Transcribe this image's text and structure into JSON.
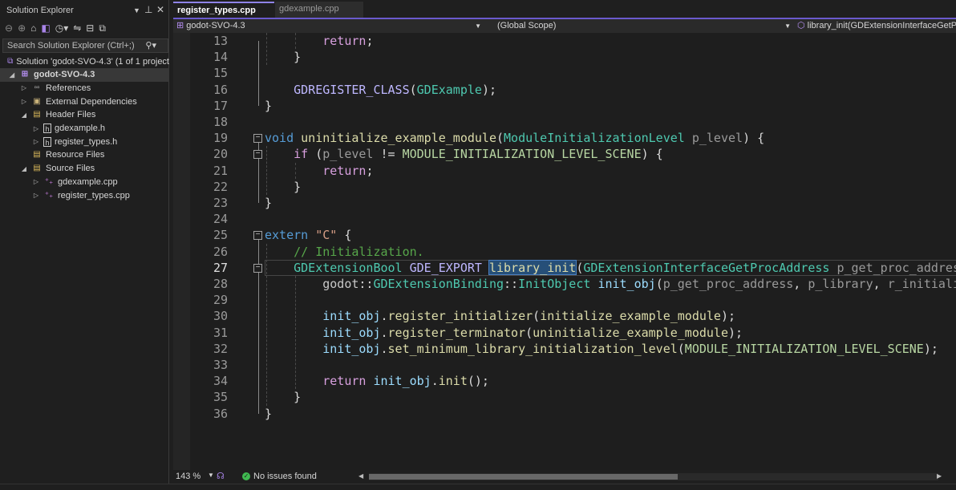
{
  "solution_explorer": {
    "title": "Solution Explorer",
    "search_placeholder": "Search Solution Explorer (Ctrl+;)",
    "tree": [
      {
        "label": "Solution 'godot-SVO-4.3' (1 of 1 project",
        "depth": 0,
        "arrow": "",
        "icon": "solution-icon",
        "selected": false
      },
      {
        "label": "godot-SVO-4.3",
        "depth": 0,
        "arrow": "expanded",
        "icon": "project-icon",
        "selected": true
      },
      {
        "label": "References",
        "depth": 1,
        "arrow": "collapsed",
        "icon": "references-icon",
        "selected": false
      },
      {
        "label": "External Dependencies",
        "depth": 1,
        "arrow": "collapsed",
        "icon": "external-deps-icon",
        "selected": false
      },
      {
        "label": "Header Files",
        "depth": 1,
        "arrow": "expanded",
        "icon": "filter-folder-icon",
        "selected": false
      },
      {
        "label": "gdexample.h",
        "depth": 2,
        "arrow": "collapsed",
        "icon": "header-file-icon",
        "selected": false
      },
      {
        "label": "register_types.h",
        "depth": 2,
        "arrow": "collapsed",
        "icon": "header-file-icon",
        "selected": false
      },
      {
        "label": "Resource Files",
        "depth": 1,
        "arrow": "",
        "icon": "filter-folder-icon",
        "selected": false
      },
      {
        "label": "Source Files",
        "depth": 1,
        "arrow": "expanded",
        "icon": "filter-folder-icon",
        "selected": false
      },
      {
        "label": "gdexample.cpp",
        "depth": 2,
        "arrow": "collapsed",
        "icon": "cpp-file-icon",
        "selected": false
      },
      {
        "label": "register_types.cpp",
        "depth": 2,
        "arrow": "collapsed",
        "icon": "cpp-file-icon",
        "selected": false
      }
    ]
  },
  "tabs": [
    {
      "label": "register_types.cpp",
      "active": true
    },
    {
      "label": "gdexample.cpp",
      "active": false
    }
  ],
  "navbar": {
    "project": "godot-SVO-4.3",
    "scope": "(Global Scope)",
    "member": "library_init(GDExtensionInterfaceGetProcAddress"
  },
  "editor": {
    "current_line": 27,
    "selected_text": "library_init",
    "lines": [
      {
        "num": "13",
        "tokens": [
          [
            "        ",
            "pl"
          ],
          [
            "return",
            "ctl"
          ],
          [
            ";",
            "pl"
          ]
        ]
      },
      {
        "num": "14",
        "tokens": [
          [
            "    }",
            "pl"
          ]
        ]
      },
      {
        "num": "15",
        "tokens": []
      },
      {
        "num": "16",
        "tokens": [
          [
            "    ",
            "pl"
          ],
          [
            "GDREGISTER_CLASS",
            "mac"
          ],
          [
            "(",
            "pl"
          ],
          [
            "GDExample",
            "ty"
          ],
          [
            ");",
            "pl"
          ]
        ]
      },
      {
        "num": "17",
        "tokens": [
          [
            "}",
            "pl"
          ]
        ]
      },
      {
        "num": "18",
        "tokens": []
      },
      {
        "num": "19",
        "tokens": [
          [
            "void",
            "kw"
          ],
          [
            " ",
            "pl"
          ],
          [
            "uninitialize_example_module",
            "fn"
          ],
          [
            "(",
            "pl"
          ],
          [
            "ModuleInitializationLevel",
            "ty"
          ],
          [
            " ",
            "pl"
          ],
          [
            "p_level",
            "prm"
          ],
          [
            ") {",
            "pl"
          ]
        ]
      },
      {
        "num": "20",
        "tokens": [
          [
            "    ",
            "pl"
          ],
          [
            "if",
            "ctl"
          ],
          [
            " (",
            "pl"
          ],
          [
            "p_level",
            "prm"
          ],
          [
            " != ",
            "pl"
          ],
          [
            "MODULE_INITIALIZATION_LEVEL_SCENE",
            "en"
          ],
          [
            ") {",
            "pl"
          ]
        ]
      },
      {
        "num": "21",
        "tokens": [
          [
            "        ",
            "pl"
          ],
          [
            "return",
            "ctl"
          ],
          [
            ";",
            "pl"
          ]
        ]
      },
      {
        "num": "22",
        "tokens": [
          [
            "    }",
            "pl"
          ]
        ]
      },
      {
        "num": "23",
        "tokens": [
          [
            "}",
            "pl"
          ]
        ]
      },
      {
        "num": "24",
        "tokens": []
      },
      {
        "num": "25",
        "tokens": [
          [
            "extern",
            "kw"
          ],
          [
            " ",
            "pl"
          ],
          [
            "\"C\"",
            "str"
          ],
          [
            " {",
            "pl"
          ]
        ]
      },
      {
        "num": "26",
        "tokens": [
          [
            "    ",
            "pl"
          ],
          [
            "// Initialization.",
            "cm"
          ]
        ]
      },
      {
        "num": "27",
        "tokens": [
          [
            "    ",
            "pl"
          ],
          [
            "GDExtensionBool",
            "ty"
          ],
          [
            " ",
            "pl"
          ],
          [
            "GDE_EXPORT",
            "mac"
          ],
          [
            " ",
            "pl"
          ],
          [
            "library_init",
            "fn"
          ],
          [
            "(",
            "pl"
          ],
          [
            "GDExtensionInterfaceGetProcAddress",
            "ty"
          ],
          [
            " ",
            "pl"
          ],
          [
            "p_get_proc_address",
            "prm"
          ]
        ]
      },
      {
        "num": "28",
        "tokens": [
          [
            "        ",
            "pl"
          ],
          [
            "godot",
            "ns"
          ],
          [
            "::",
            "pl"
          ],
          [
            "GDExtensionBinding",
            "ty"
          ],
          [
            "::",
            "pl"
          ],
          [
            "InitObject",
            "ty"
          ],
          [
            " ",
            "pl"
          ],
          [
            "init_obj",
            "var"
          ],
          [
            "(",
            "pl"
          ],
          [
            "p_get_proc_address",
            "prm"
          ],
          [
            ", ",
            "pl"
          ],
          [
            "p_library",
            "prm"
          ],
          [
            ", ",
            "pl"
          ],
          [
            "r_initialization",
            "prm"
          ]
        ]
      },
      {
        "num": "29",
        "tokens": []
      },
      {
        "num": "30",
        "tokens": [
          [
            "        ",
            "pl"
          ],
          [
            "init_obj",
            "var"
          ],
          [
            ".",
            "pl"
          ],
          [
            "register_initializer",
            "fn"
          ],
          [
            "(",
            "pl"
          ],
          [
            "initialize_example_module",
            "fn"
          ],
          [
            ");",
            "pl"
          ]
        ]
      },
      {
        "num": "31",
        "tokens": [
          [
            "        ",
            "pl"
          ],
          [
            "init_obj",
            "var"
          ],
          [
            ".",
            "pl"
          ],
          [
            "register_terminator",
            "fn"
          ],
          [
            "(",
            "pl"
          ],
          [
            "uninitialize_example_module",
            "fn"
          ],
          [
            ");",
            "pl"
          ]
        ]
      },
      {
        "num": "32",
        "tokens": [
          [
            "        ",
            "pl"
          ],
          [
            "init_obj",
            "var"
          ],
          [
            ".",
            "pl"
          ],
          [
            "set_minimum_library_initialization_level",
            "fn"
          ],
          [
            "(",
            "pl"
          ],
          [
            "MODULE_INITIALIZATION_LEVEL_SCENE",
            "en"
          ],
          [
            ");",
            "pl"
          ]
        ]
      },
      {
        "num": "33",
        "tokens": []
      },
      {
        "num": "34",
        "tokens": [
          [
            "        ",
            "pl"
          ],
          [
            "return",
            "ctl"
          ],
          [
            " ",
            "pl"
          ],
          [
            "init_obj",
            "var"
          ],
          [
            ".",
            "pl"
          ],
          [
            "init",
            "fn"
          ],
          [
            "();",
            "pl"
          ]
        ]
      },
      {
        "num": "35",
        "tokens": [
          [
            "    }",
            "pl"
          ]
        ]
      },
      {
        "num": "36",
        "tokens": [
          [
            "}",
            "pl"
          ]
        ]
      }
    ]
  },
  "status": {
    "zoom": "143 %",
    "issues": "No issues found"
  },
  "colors": {
    "accent": "#8f83e8",
    "ok": "#3fb950",
    "selection": "#264f78"
  }
}
